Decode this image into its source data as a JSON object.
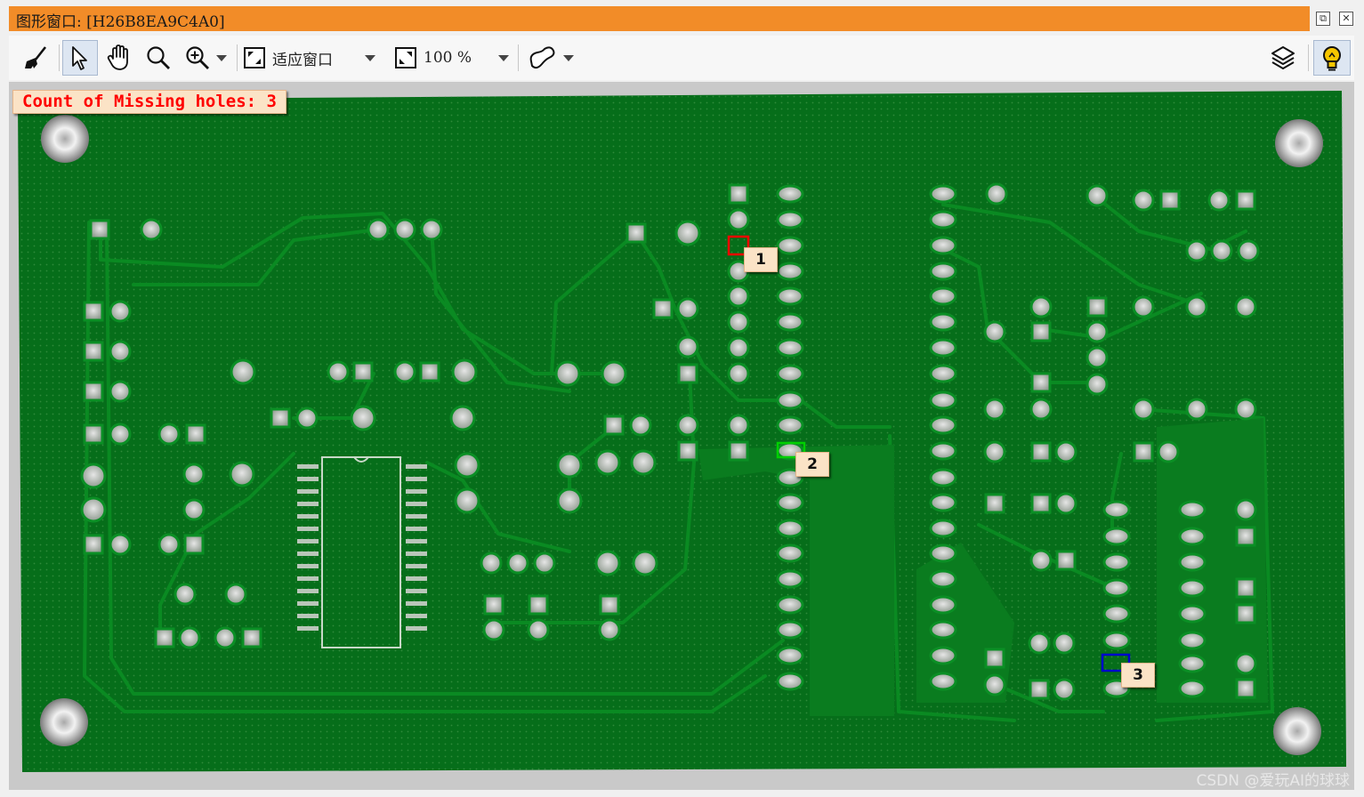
{
  "window": {
    "title": "图形窗口: [H26B8EA9C4A0]",
    "accent_color": "#f28c28",
    "restore_label": "⧉",
    "close_label": "✕"
  },
  "toolbar": {
    "clear_icon": "broom-icon",
    "select_icon": "pointer-icon",
    "pan_icon": "hand-icon",
    "zoom_icon": "magnifier-icon",
    "zoom_in_icon": "zoom-in-icon",
    "fit_label": "适应窗口",
    "zoom_percent": "100 %",
    "roi_icon": "shape-icon",
    "layers_icon": "layers-icon",
    "hint_icon": "lightbulb-icon"
  },
  "canvas": {
    "message": "Count of Missing holes: 3",
    "message_color": "#ff0000",
    "board_color": "#066e1a",
    "defects": [
      {
        "label": "1",
        "color": "#ff0000"
      },
      {
        "label": "2",
        "color": "#00d000"
      },
      {
        "label": "3",
        "color": "#0000cc"
      }
    ]
  },
  "watermark": "CSDN @爱玩AI的球球"
}
